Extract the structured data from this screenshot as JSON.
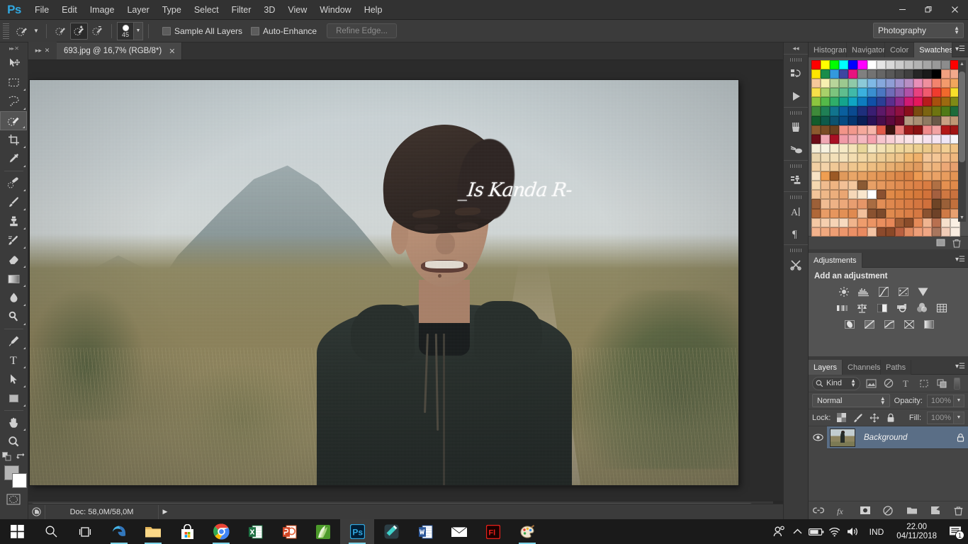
{
  "app": {
    "name": "Adobe Photoshop",
    "logo": "Ps"
  },
  "menubar": {
    "items": [
      "File",
      "Edit",
      "Image",
      "Layer",
      "Type",
      "Select",
      "Filter",
      "3D",
      "View",
      "Window",
      "Help"
    ]
  },
  "window_controls": {
    "minimize": "—",
    "restore": "❐",
    "close": "✕"
  },
  "options_bar": {
    "tool": "quick-selection-tool",
    "modes": [
      "new-selection",
      "add-to-selection",
      "subtract-from-selection"
    ],
    "active_mode_index": 1,
    "brush_size": "45",
    "sample_all_layers": {
      "label": "Sample All Layers",
      "checked": false
    },
    "auto_enhance": {
      "label": "Auto-Enhance",
      "checked": false
    },
    "refine_edge": {
      "label": "Refine Edge...",
      "enabled": false
    },
    "workspace": {
      "value": "Photography"
    }
  },
  "toolbar": {
    "tools": [
      {
        "name": "move-tool",
        "has_flyout": false
      },
      {
        "name": "rectangular-marquee-tool",
        "has_flyout": true
      },
      {
        "name": "lasso-tool",
        "has_flyout": true
      },
      {
        "name": "quick-selection-tool",
        "has_flyout": true,
        "active": true
      },
      {
        "name": "crop-tool",
        "has_flyout": true
      },
      {
        "name": "eyedropper-tool",
        "has_flyout": true
      },
      {
        "name": "spot-healing-brush-tool",
        "has_flyout": true
      },
      {
        "name": "brush-tool",
        "has_flyout": true
      },
      {
        "name": "clone-stamp-tool",
        "has_flyout": true
      },
      {
        "name": "history-brush-tool",
        "has_flyout": true
      },
      {
        "name": "eraser-tool",
        "has_flyout": true
      },
      {
        "name": "gradient-tool",
        "has_flyout": true
      },
      {
        "name": "blur-tool",
        "has_flyout": true
      },
      {
        "name": "dodge-tool",
        "has_flyout": true
      },
      {
        "name": "pen-tool",
        "has_flyout": true
      },
      {
        "name": "horizontal-type-tool",
        "has_flyout": true
      },
      {
        "name": "path-selection-tool",
        "has_flyout": true
      },
      {
        "name": "rectangle-tool",
        "has_flyout": true
      },
      {
        "name": "hand-tool",
        "has_flyout": true
      },
      {
        "name": "zoom-tool",
        "has_flyout": false
      }
    ],
    "foreground_color": "#b5b5b5",
    "background_color": "#ffffff",
    "quick_mask": "edit-in-quick-mask-mode"
  },
  "document": {
    "tab_title": "693.jpg @ 16,7% (RGB/8*)",
    "zoom": "16,7%",
    "color_mode": "RGB/8*",
    "signature_text": "_Is Kanda R-"
  },
  "status_bar": {
    "doc_size": "Doc: 58,0M/58,0M"
  },
  "dock_strip": {
    "collapse": "collapse-panels",
    "icons": [
      "history-panel-icon",
      "actions-panel-icon",
      "brush-panel-icon",
      "tool-presets-panel-icon",
      "clone-source-panel-icon",
      "character-panel-icon",
      "paragraph-panel-icon",
      "tool-preset-picker-icon"
    ]
  },
  "panels": {
    "color_group": {
      "tabs": [
        "Histogram",
        "Navigator",
        "Color",
        "Swatches"
      ],
      "active_tab": "Swatches",
      "swatch_rows": [
        [
          "#ff0000",
          "#ffff00",
          "#00ff00",
          "#00ffff",
          "#0000ff",
          "#ff00ff",
          "#ffffff",
          "#e6e6e6",
          "#d9d9d9",
          "#cccccc",
          "#bfbfbf",
          "#b3b3b3",
          "#a6a6a6",
          "#999999",
          "#8c8c8c",
          "#ff0000"
        ],
        [
          "#ffe600",
          "#1a8c4a",
          "#3399dd",
          "#3d46a0",
          "#e6147f",
          "#808080",
          "#737373",
          "#666666",
          "#595959",
          "#4d4d4d",
          "#404040",
          "#262626",
          "#1a1a1a",
          "#000000",
          "#f0a080",
          "#f2a98c"
        ],
        [
          "#f6c89a",
          "#f7f0b0",
          "#b8d49a",
          "#9cc98f",
          "#8fc9a8",
          "#8cc9d8",
          "#7fb9e6",
          "#86a8dd",
          "#8f9ed6",
          "#a394cf",
          "#b88fc4",
          "#e88fb8",
          "#ef8f9e",
          "#f3846e",
          "#f39a6c",
          "#f2a65c"
        ],
        [
          "#f7e04a",
          "#a8d06a",
          "#7cc47e",
          "#5fbd8e",
          "#41b9a8",
          "#3bb0de",
          "#3a8fd0",
          "#4a77c2",
          "#6f6cb8",
          "#8c63b0",
          "#b052a8",
          "#e8427f",
          "#f05a6e",
          "#ef3b2e",
          "#f0692c",
          "#f7e02a"
        ],
        [
          "#8dc63f",
          "#54b949",
          "#2fae6a",
          "#14a58d",
          "#0fa5c4",
          "#0d7cc0",
          "#1050a8",
          "#2a3f96",
          "#5b2f8e",
          "#8e2a8c",
          "#d01a73",
          "#e5175c",
          "#b71c1c",
          "#a8500e",
          "#9c6a10",
          "#7f8a16"
        ],
        [
          "#3f8a3a",
          "#1f7f55",
          "#11748e",
          "#0a5f9e",
          "#0a4a90",
          "#1e2f7c",
          "#3a1e72",
          "#5c1968",
          "#7a1458",
          "#8f1040",
          "#8a0f1c",
          "#7a4a10",
          "#7c6411",
          "#6e7410",
          "#4f7a16",
          "#1d6b3a"
        ],
        [
          "#135c2c",
          "#0d5a4a",
          "#0c5270",
          "#064a82",
          "#05356f",
          "#0a1f56",
          "#2a1256",
          "#480e4c",
          "#5e0a3e",
          "#6b0826",
          "#b49a82",
          "#a98f74",
          "#8f7a62",
          "#6b5848",
          "#c9a183",
          "#bf9774"
        ],
        [
          "#8c5a2e",
          "#7a4c26",
          "#6b4120",
          "#f29488",
          "#f2988c",
          "#f5a89b",
          "#f7b6aa",
          "#e05a4a",
          "#3a1410",
          "#e87a78",
          "#9c1b1b",
          "#8a1212",
          "#ef8a8a",
          "#f2a2a2",
          "#b21818",
          "#a01414"
        ],
        [
          "#6b0d18",
          "#f0a8b4",
          "#a81024",
          "#f09aa6",
          "#f2aab2",
          "#f4b8c0",
          "#f6a2ae",
          "#f7c4cc",
          "#f8cfd6",
          "#f9dce0",
          "#fae4e8",
          "#fbeaec",
          "#f6e2ee",
          "#f4e4f2",
          "#eee6f6",
          "#f6f6fa"
        ],
        [
          "#f5eed8",
          "#f7f2e0",
          "#f7edcf",
          "#f6eac6",
          "#f4e4b8",
          "#e8d79a",
          "#f5e9c4",
          "#f3e2b4",
          "#f1dda6",
          "#efd79a",
          "#f0d49a",
          "#eccf90",
          "#ebc98a",
          "#eec38a",
          "#f2cf94",
          "#f0c384"
        ],
        [
          "#e8d3ab",
          "#f0dcb6",
          "#f2dfb8",
          "#f4e2bc",
          "#f3ddb0",
          "#f2d8a6",
          "#f0d4a0",
          "#eecd96",
          "#edc88e",
          "#eec48a",
          "#f0b972",
          "#efb06a",
          "#f4c79a",
          "#f4c696",
          "#f2bd8a",
          "#f0b87e"
        ],
        [
          "#f2cfa2",
          "#f3d2a8",
          "#f0c896",
          "#eec292",
          "#efc68e",
          "#f2c68a",
          "#eebe82",
          "#ecb87a",
          "#e8af72",
          "#e5a868",
          "#e2a062",
          "#e09a5e",
          "#eeb882",
          "#eeb47c",
          "#eca876",
          "#e8a06e"
        ],
        [
          "#f7e2c4",
          "#ef9e52",
          "#9c5a26",
          "#e09a5c",
          "#e9a668",
          "#e7a162",
          "#e59a5a",
          "#e29454",
          "#df8e4e",
          "#dc8748",
          "#d98244",
          "#ed9a52",
          "#eaa468",
          "#eaa266",
          "#e89c5e",
          "#e49454"
        ],
        [
          "#f5d8b0",
          "#f0bc8e",
          "#eeb482",
          "#f2c096",
          "#f4c89e",
          "#8a5a34",
          "#e8a066",
          "#e6995e",
          "#e39256",
          "#e18c50",
          "#de864a",
          "#dc8046",
          "#d97c42",
          "#b07044",
          "#e49050",
          "#e08a4a"
        ],
        [
          "#f2c49a",
          "#efb888",
          "#ecae7c",
          "#eaa672",
          "#f6d8b8",
          "#f9e6cc",
          "#ffffff",
          "#8a5030",
          "#e08a48",
          "#dd8442",
          "#d97e3e",
          "#d5783a",
          "#d2723a",
          "#a46040",
          "#cf7842",
          "#c9723e"
        ],
        [
          "#9c6038",
          "#f0bc92",
          "#eeb286",
          "#eca87a",
          "#e89e70",
          "#e69668",
          "#a86c42",
          "#e28e56",
          "#df884e",
          "#dc8248",
          "#d87c44",
          "#d47640",
          "#d0703c",
          "#6e4426",
          "#9a6038",
          "#c2703c"
        ],
        [
          "#b06838",
          "#e89c66",
          "#e6965e",
          "#e29056",
          "#e08a50",
          "#f2c09c",
          "#8a5230",
          "#7c4a2c",
          "#e08a4e",
          "#dd844a",
          "#da7e46",
          "#d67842",
          "#8a5230",
          "#6e4228",
          "#cf7a46",
          "#e8a070"
        ],
        [
          "#f4c8a4",
          "#f5cfae",
          "#f6d4b6",
          "#f7dac0",
          "#f0b48c",
          "#ee9c6c",
          "#ec9464",
          "#ea8e5e",
          "#e88858",
          "#a05c34",
          "#8a4c2a",
          "#e68a58",
          "#f0b490",
          "#b87050",
          "#f6e0cc",
          "#fbf0e4"
        ],
        [
          "#f2b28c",
          "#f0a87e",
          "#ee9e74",
          "#ec966c",
          "#eb9066",
          "#e98a60",
          "#f4c4a4",
          "#8c4a2c",
          "#8a4828",
          "#b86040",
          "#e08a60",
          "#ee9e78",
          "#f0a684",
          "#a8765e",
          "#f2cdb8",
          "#f9ece0"
        ]
      ]
    },
    "adjustments": {
      "tab": "Adjustments",
      "heading": "Add an adjustment",
      "row1": [
        "brightness-contrast-icon",
        "levels-icon",
        "curves-icon",
        "exposure-icon",
        "vibrance-icon"
      ],
      "row2": [
        "hue-saturation-icon",
        "color-balance-icon",
        "black-white-icon",
        "photo-filter-icon",
        "channel-mixer-icon",
        "color-lookup-icon"
      ],
      "row3": [
        "invert-icon",
        "posterize-icon",
        "threshold-icon",
        "gradient-map-icon",
        "selective-color-icon"
      ]
    },
    "layers": {
      "tabs": [
        "Layers",
        "Channels",
        "Paths"
      ],
      "active_tab": "Layers",
      "filter_kind": "Kind",
      "filter_icons": [
        "filter-pixel-icon",
        "filter-adjustment-icon",
        "filter-type-icon",
        "filter-shape-icon",
        "filter-smart-object-icon"
      ],
      "blend_mode": "Normal",
      "opacity_label": "Opacity:",
      "opacity_value": "100%",
      "lock_label": "Lock:",
      "lock_icons": [
        "lock-transparent-pixels-icon",
        "lock-image-pixels-icon",
        "lock-position-icon",
        "lock-all-icon"
      ],
      "fill_label": "Fill:",
      "fill_value": "100%",
      "rows": [
        {
          "name": "Background",
          "visible": true,
          "locked": true
        }
      ],
      "footer_icons": [
        "link-layers-icon",
        "layer-style-fx-icon",
        "add-layer-mask-icon",
        "new-adjustment-layer-icon",
        "new-group-icon",
        "new-layer-icon",
        "delete-layer-icon"
      ]
    }
  },
  "taskbar": {
    "start": "windows-start-icon",
    "search": "search-icon",
    "task_view": "task-view-icon",
    "apps": [
      {
        "name": "edge-icon",
        "running": true
      },
      {
        "name": "file-explorer-icon",
        "running": true
      },
      {
        "name": "microsoft-store-icon",
        "running": false
      },
      {
        "name": "google-chrome-icon",
        "running": true
      },
      {
        "name": "excel-icon",
        "running": false
      },
      {
        "name": "powerpoint-icon",
        "running": false
      },
      {
        "name": "corel-icon",
        "running": false
      },
      {
        "name": "photoshop-icon",
        "running": true,
        "active": true
      },
      {
        "name": "filmora-icon",
        "running": false
      },
      {
        "name": "word-icon",
        "running": false
      },
      {
        "name": "mail-icon",
        "running": false
      },
      {
        "name": "adobe-flash-icon",
        "running": false
      },
      {
        "name": "paint-icon",
        "running": true
      }
    ],
    "tray": {
      "icons": [
        "people-icon",
        "show-hidden-icons-chevron",
        "battery-icon",
        "wifi-icon",
        "volume-icon"
      ],
      "language": "IND",
      "time": "22.00",
      "date": "04/11/2018",
      "notification_count": "1"
    }
  }
}
